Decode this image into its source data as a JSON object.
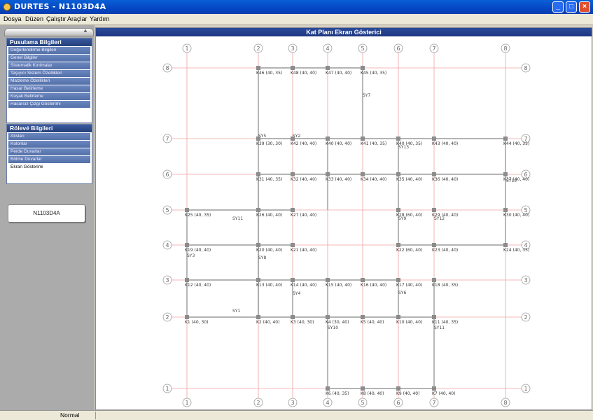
{
  "window": {
    "title": "DURTES - N1103D4A"
  },
  "menu": [
    "Dosya",
    "Düzen",
    "Çalıştır",
    "Araçlar",
    "Yardım"
  ],
  "sidebar": {
    "panel1": {
      "header": "Pusulama Bilgileri",
      "items": [
        "Değerlendirme Bilgileri",
        "Genel Bilgiler",
        "Sistematik Kırılmalar",
        "Taşıyıcı Sistem Özellikleri",
        "Malzeme Özellikleri",
        "Hasar Belirleme",
        "Kuşak Belirleme",
        "Hasarsız Çizgi Gösterimi"
      ]
    },
    "panel2": {
      "header": "Rölevé Bilgileri",
      "items": [
        "Aksları",
        "Kolonlar",
        "Perde Duvarlar",
        "Bölme Duvarlar",
        "Ekran Gösterimi"
      ],
      "selected_index": 4
    },
    "project_button": "N1103D4A"
  },
  "plan": {
    "title": "Kat Planı Ekran Gösterici",
    "x_axes": [
      "1",
      "2",
      "3",
      "4",
      "5",
      "6",
      "7",
      "8"
    ],
    "y_axes": [
      "8",
      "7",
      "6",
      "5",
      "4",
      "3",
      "2",
      "1"
    ],
    "columns": [
      {
        "label": "K46 (40, 35)"
      },
      {
        "label": "K48 (40, 40)"
      },
      {
        "label": "K47 (40, 40)"
      },
      {
        "label": "K45 (40, 35)"
      },
      {
        "label": "K39 (30, 30)"
      },
      {
        "label": "K42 (40, 40)"
      },
      {
        "label": "K40 (40, 40)"
      },
      {
        "label": "K41 (40, 35)"
      },
      {
        "label": "K40 (40, 35)"
      },
      {
        "label": "K43 (40, 40)"
      },
      {
        "label": "K44 (40, 35)"
      },
      {
        "label": "K31 (40, 35)"
      },
      {
        "label": "K32 (40, 40)"
      },
      {
        "label": "K33 (40, 40)"
      },
      {
        "label": "K34 (40, 40)"
      },
      {
        "label": "K35 (40, 40)"
      },
      {
        "label": "K36 (40, 40)"
      },
      {
        "label": "K37 (40, 40)"
      },
      {
        "label": "K25 (40, 35)"
      },
      {
        "label": "K26 (40, 40)"
      },
      {
        "label": "K27 (40, 40)"
      },
      {
        "label": "K28 (60, 40)"
      },
      {
        "label": "K29 (40, 40)"
      },
      {
        "label": "K30 (40, 40)"
      },
      {
        "label": "K19 (40, 40)"
      },
      {
        "label": "K20 (40, 40)"
      },
      {
        "label": "K21 (40, 40)"
      },
      {
        "label": "K22 (60, 40)"
      },
      {
        "label": "K23 (40, 40)"
      },
      {
        "label": "K24 (40, 35)"
      },
      {
        "label": "K12 (40, 40)"
      },
      {
        "label": "K13 (40, 40)"
      },
      {
        "label": "K14 (40, 40)"
      },
      {
        "label": "K15 (40, 40)"
      },
      {
        "label": "K16 (40, 40)"
      },
      {
        "label": "K17 (40, 40)"
      },
      {
        "label": "K18 (40, 35)"
      },
      {
        "label": "K1 (40, 30)"
      },
      {
        "label": "K2 (40, 40)"
      },
      {
        "label": "K3 (40, 30)"
      },
      {
        "label": "K4 (30, 40)"
      },
      {
        "label": "K5 (40, 40)"
      },
      {
        "label": "K10 (40, 40)"
      },
      {
        "label": "K11 (40, 35)"
      },
      {
        "label": "K6 (40, 35)"
      },
      {
        "label": "K8 (40, 40)"
      },
      {
        "label": "K9 (40, 40)"
      },
      {
        "label": "K7 (40, 40)"
      }
    ],
    "walls": [
      "SY7",
      "SY13",
      "SY15",
      "SY12",
      "SY9",
      "SY11",
      "SY3",
      "SY8",
      "SY6",
      "SY1",
      "SY10",
      "SY11",
      "SY4",
      "SY2",
      "SY5"
    ]
  },
  "status": {
    "text": "Normal"
  }
}
